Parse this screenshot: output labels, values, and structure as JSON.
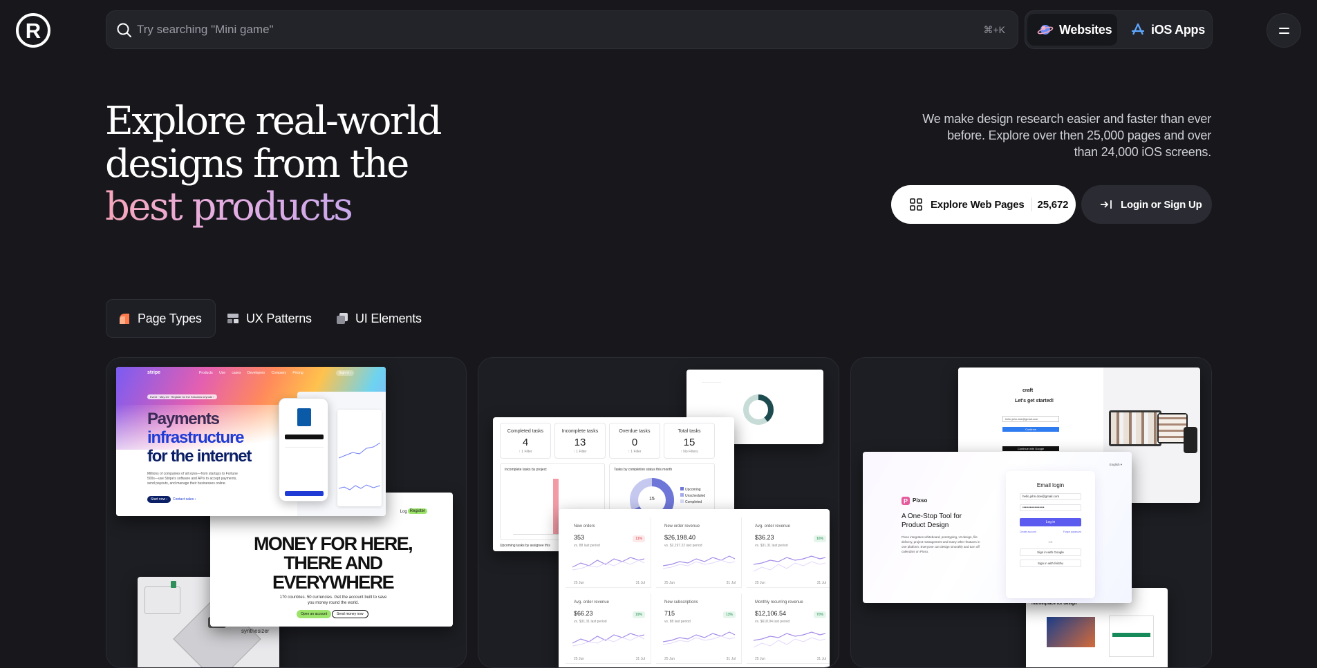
{
  "brand": {
    "logo_glyph": "R"
  },
  "search": {
    "placeholder": "Try searching \"Mini game\"",
    "shortcut": "⌘+K"
  },
  "platform_switch": [
    {
      "label": "Websites",
      "icon": "planet-icon",
      "active": true
    },
    {
      "label": "iOS Apps",
      "icon": "app-store-icon",
      "active": false
    }
  ],
  "hero": {
    "title_line1": "Explore real-world",
    "title_line2": "designs from the",
    "title_line3": "best products",
    "description": "We make design research easier and faster than ever before. Explore over then 25,000 pages and over than 24,000 iOS screens.",
    "explore_label": "Explore Web Pages",
    "explore_count": "25,672",
    "login_label": "Login or Sign Up"
  },
  "tabs": [
    {
      "label": "Page Types",
      "icon": "page-types-icon",
      "active": true
    },
    {
      "label": "UX Patterns",
      "icon": "ux-patterns-icon",
      "active": false
    },
    {
      "label": "UI Elements",
      "icon": "ui-elements-icon",
      "active": false
    }
  ],
  "cards": {
    "stripe": {
      "logo": "stripe",
      "nav": [
        "Products",
        "Use cases",
        "Developers",
        "Company",
        "Pricing"
      ],
      "signin": "Sign in ›",
      "announce": "Event · May 24 · Register for the Sessions keynote ›",
      "headline_1": "Payments",
      "headline_2": "infrastructure",
      "headline_3": "for the internet",
      "body": "Millions of companies of all sizes—from startups to Fortune 500s—use Stripe's software and APIs to accept payments, send payouts, and manage their businesses online.",
      "cta_primary": "Start now ›",
      "cta_secondary": "Contact sales ›",
      "money_headline": "MONEY FOR HERE, THERE AND EVERYWHERE",
      "money_body": "170 countries. 50 currencies. Get the account built to save you money round the world.",
      "money_cta_primary": "Open an account",
      "money_cta_secondary": "Send money now",
      "money_nav_login": "Log in",
      "money_nav_register": "Register",
      "synth_label": "synthesizer"
    },
    "dashboard": {
      "stats": [
        {
          "label": "Completed tasks",
          "value": "4",
          "sub": "↑ 1 Filter"
        },
        {
          "label": "Incomplete tasks",
          "value": "13",
          "sub": "↑ 1 Filter"
        },
        {
          "label": "Overdue tasks",
          "value": "0",
          "sub": "↑ 1 Filter"
        },
        {
          "label": "Total tasks",
          "value": "15",
          "sub": "↑ No Filters"
        }
      ],
      "chart_left_title": "Incomplete tasks by project",
      "chart_right_title": "Tasks by completion status this month",
      "donut_center": "15",
      "legend": [
        "Upcoming",
        "Unscheduled",
        "Completed"
      ],
      "bottom_label": "Upcoming tasks by assignee this",
      "metrics": [
        {
          "label": "New orders",
          "value": "353",
          "sub": "vs. 88 last period",
          "badge": "11%",
          "trend": "down"
        },
        {
          "label": "New order revenue",
          "value": "$26,198.40",
          "sub": "vs. $2,197.22 last period",
          "badge": "",
          "trend": "up"
        },
        {
          "label": "Avg. order revenue",
          "value": "$36.23",
          "sub": "vs. $31.31 last period",
          "badge": "16%",
          "trend": "up"
        },
        {
          "label": "Avg. order revenue",
          "value": "$66.23",
          "sub": "vs. $31.31 last period",
          "badge": "19%",
          "trend": "up"
        },
        {
          "label": "New subscriptions",
          "value": "715",
          "sub": "vs. 88 last period",
          "badge": "13%",
          "trend": "up"
        },
        {
          "label": "Monthly recurring revenue",
          "value": "$12,106.54",
          "sub": "vs. $618.94 last period",
          "badge": "70%",
          "trend": "up"
        }
      ],
      "axis_start": "25 Jun",
      "axis_end": "31 Jul"
    },
    "pixso": {
      "craft_logo": "craft",
      "craft_heading": "Let's get started!",
      "craft_email": "hello.john.doe@gmail.com",
      "craft_continue": "Continue",
      "craft_google": "Continue with Google",
      "brand": "Pixso",
      "headline": "A One-Stop Tool for Product Design",
      "body": "Pixso integrates whiteboard, prototyping, UI design, file delivery, project management and many other features in one platform. Everyone can design smoothly and turn off calendars on Pixso.",
      "lang": "English ▾",
      "login_title": "Email login",
      "email_value": "hello.john.doe@gmail.com",
      "password_dots": "••••••••••••••••••",
      "login_btn": "Log in",
      "create_account": "Create account",
      "forgot": "Forgot password",
      "or": "OR",
      "google_signin": "Sign in with Google",
      "feishu_signin": "Sign in with feiShu",
      "marketplace": "marketplace for design"
    }
  },
  "colors": {
    "background": "#17171c",
    "surface": "#23242a",
    "stripe_blue": "#1f3bd6",
    "pixso_purple": "#5b5bf0"
  }
}
